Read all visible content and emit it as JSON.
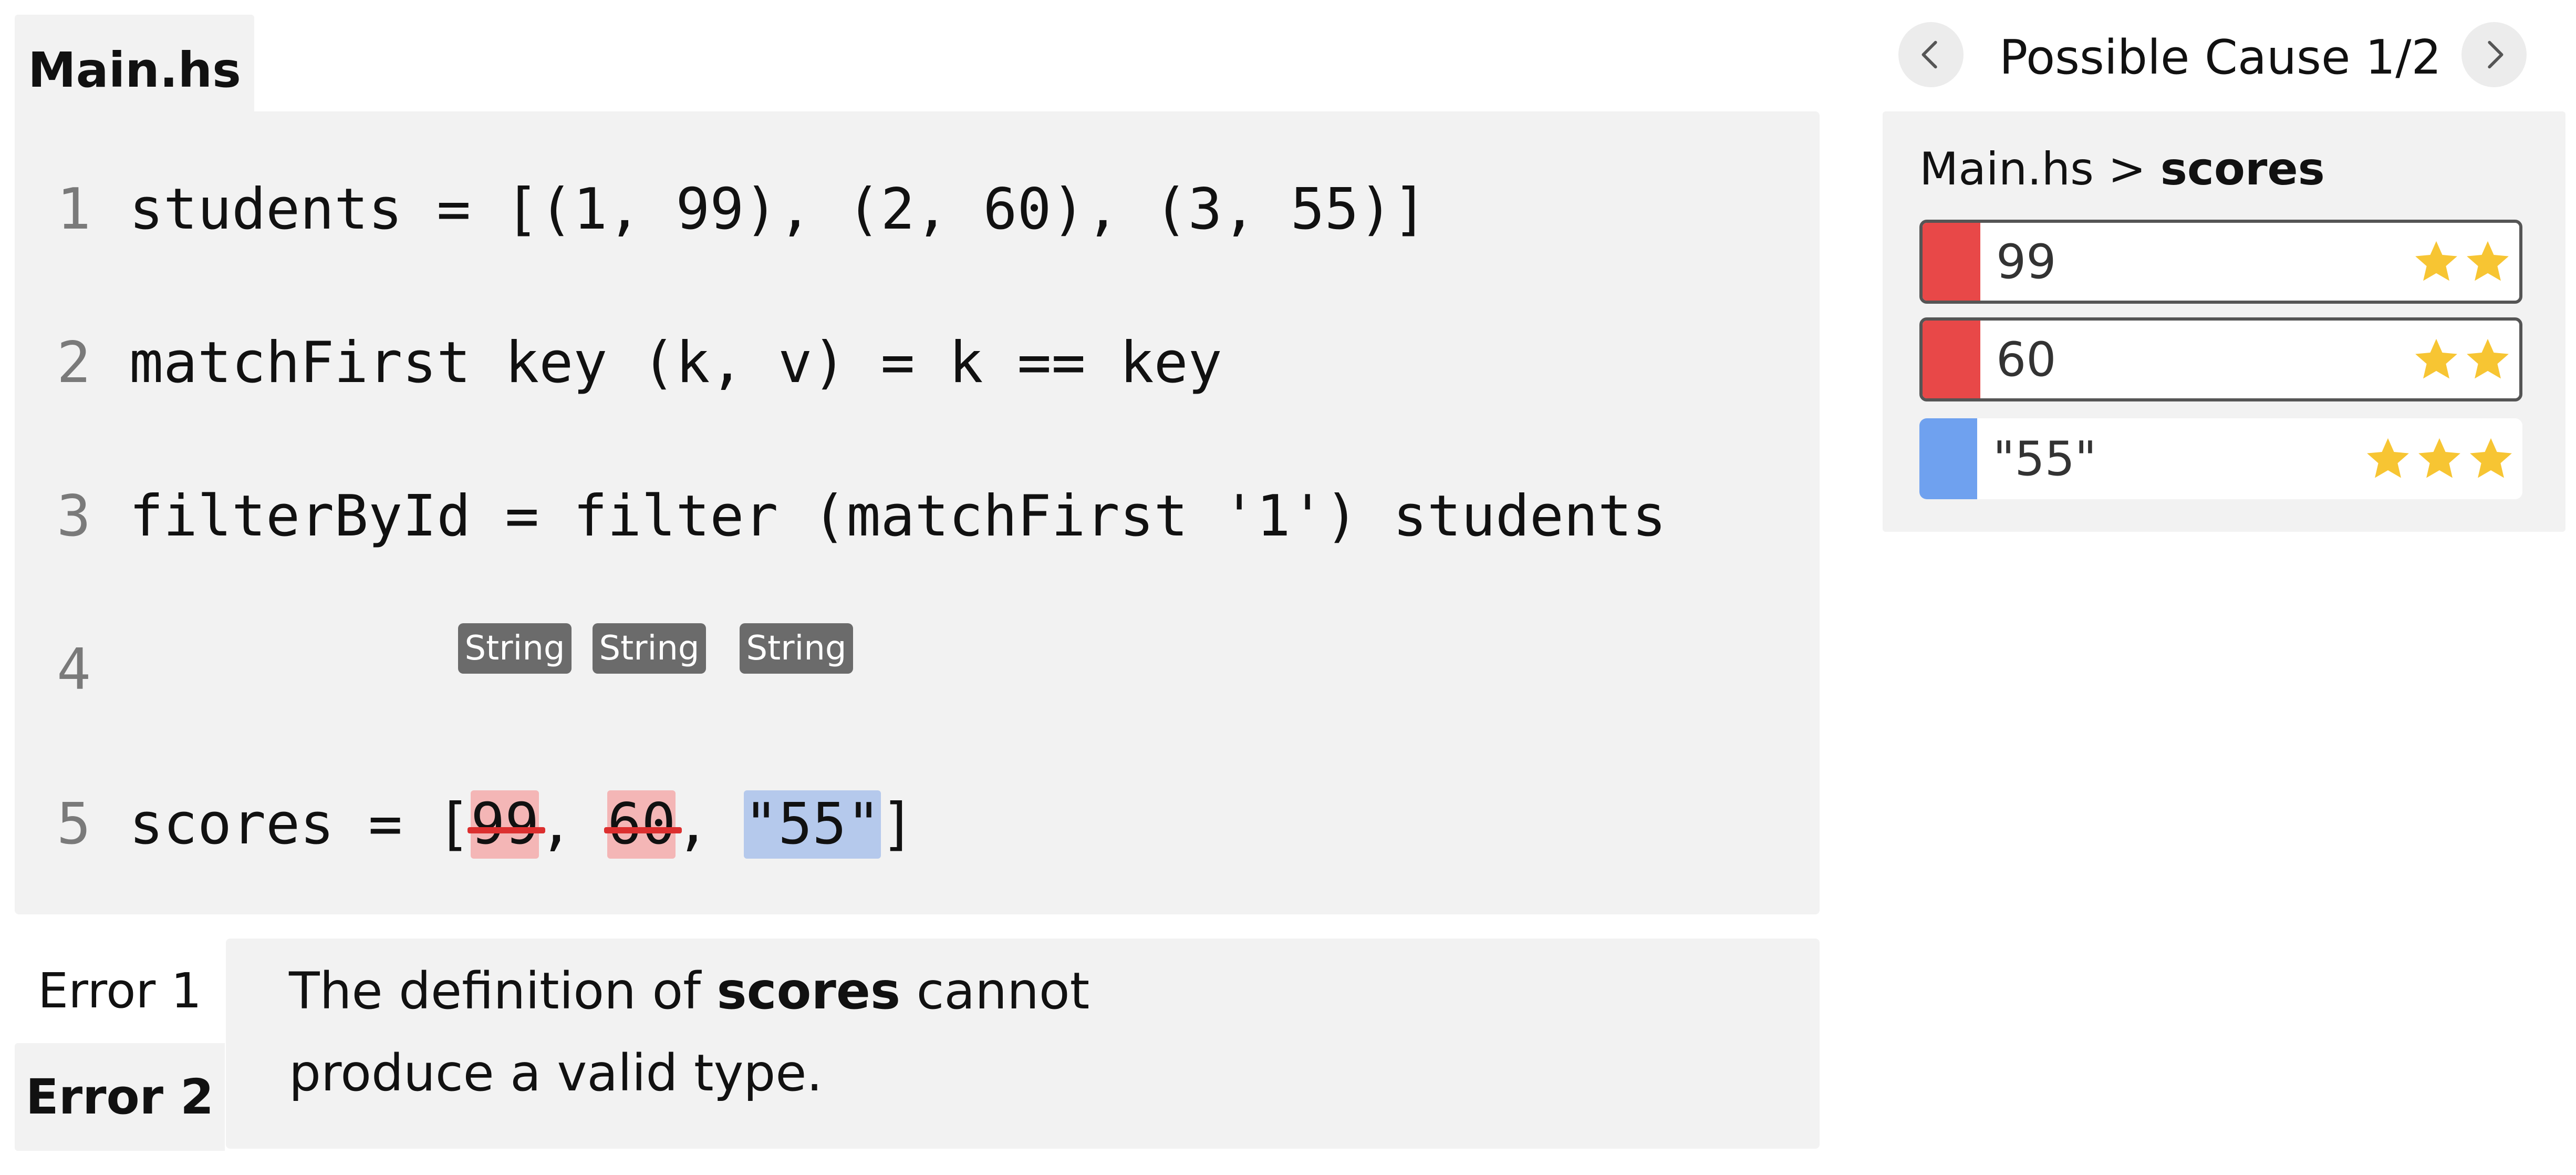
{
  "editor": {
    "file_tab": "Main.hs",
    "lines": [
      {
        "num": "1",
        "code": "students = [(1, 99), (2, 60), (3, 55)]"
      },
      {
        "num": "2",
        "code": "matchFirst key (k, v) = k == key"
      },
      {
        "num": "3",
        "code": "filterById = filter (matchFirst '1') students"
      },
      {
        "num": "4",
        "code": ""
      },
      {
        "num": "5",
        "prefix": "scores = [",
        "tokens": [
          "99",
          "60",
          "\"55\""
        ],
        "sep": ", ",
        "suffix": "]"
      }
    ],
    "type_badges": [
      "String",
      "String",
      "String"
    ]
  },
  "errors": {
    "tabs": [
      "Error 1",
      "Error 2"
    ],
    "active_tab": "Error 2",
    "message": {
      "before": "The definition of ",
      "bold": "scores",
      "after": " cannot",
      "line2": "produce a valid type."
    }
  },
  "causes": {
    "title": "Possible Cause 1/2",
    "breadcrumb": {
      "file": "Main.hs",
      "sep": " > ",
      "symbol": "scores"
    },
    "items": [
      {
        "value": "99",
        "stars": 2,
        "bar_color": "#e84848"
      },
      {
        "value": "60",
        "stars": 2,
        "bar_color": "#e84848"
      },
      {
        "value": "\"55\"",
        "stars": 3,
        "bar_color": "#6fa1ef"
      }
    ],
    "star_color": "#f7c533",
    "prev_icon": "chevron-left-icon",
    "next_icon": "chevron-right-icon"
  }
}
